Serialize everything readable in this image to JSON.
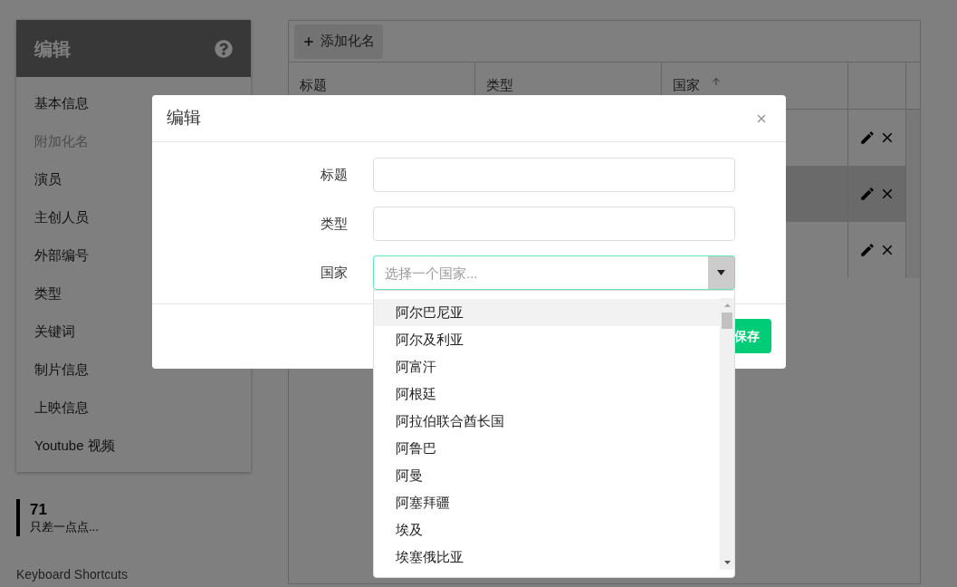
{
  "sidebar": {
    "title": "编辑",
    "items": [
      {
        "label": "基本信息",
        "selected": false
      },
      {
        "label": "附加化名",
        "selected": true
      },
      {
        "label": "演员",
        "selected": false
      },
      {
        "label": "主创人员",
        "selected": false
      },
      {
        "label": "外部编号",
        "selected": false
      },
      {
        "label": "类型",
        "selected": false
      },
      {
        "label": "关键词",
        "selected": false
      },
      {
        "label": "制片信息",
        "selected": false
      },
      {
        "label": "上映信息",
        "selected": false
      },
      {
        "label": "Youtube 视频",
        "selected": false
      }
    ]
  },
  "progress": {
    "value": "71",
    "caption": "只差一点点..."
  },
  "footer_link": "Keyboard Shortcuts",
  "table": {
    "add_button": "添加化名",
    "columns": [
      {
        "label": "标题",
        "sorted": false
      },
      {
        "label": "类型",
        "sorted": false
      },
      {
        "label": "国家",
        "sorted": true
      }
    ],
    "rows": [
      {
        "striped": false
      },
      {
        "striped": true
      },
      {
        "striped": false
      }
    ]
  },
  "dialog": {
    "title": "编辑",
    "fields": [
      {
        "label": "标题",
        "kind": "text",
        "focused": false
      },
      {
        "label": "类型",
        "kind": "text",
        "focused": false
      },
      {
        "label": "国家",
        "kind": "select",
        "placeholder": "选择一个国家...",
        "focused": true
      }
    ],
    "save_button": "保存",
    "dropdown": {
      "options": [
        {
          "label": "阿尔巴尼亚",
          "selected": true
        },
        {
          "label": "阿尔及利亚",
          "selected": false
        },
        {
          "label": "阿富汗",
          "selected": false
        },
        {
          "label": "阿根廷",
          "selected": false
        },
        {
          "label": "阿拉伯联合酋长国",
          "selected": false
        },
        {
          "label": "阿鲁巴",
          "selected": false
        },
        {
          "label": "阿曼",
          "selected": false
        },
        {
          "label": "阿塞拜疆",
          "selected": false
        },
        {
          "label": "埃及",
          "selected": false
        },
        {
          "label": "埃塞俄比亚",
          "selected": false
        }
      ]
    }
  }
}
